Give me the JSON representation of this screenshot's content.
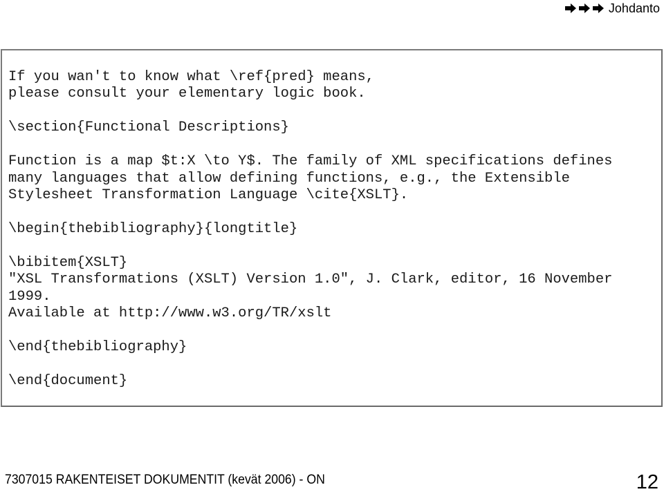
{
  "nav": {
    "icons": [
      "arrow-right-icon",
      "arrow-right-icon",
      "arrow-right-icon"
    ],
    "label": "Johdanto"
  },
  "code": {
    "lines": [
      "If you wan't to know what \\ref{pred} means,",
      "please consult your elementary logic book.",
      "",
      "\\section{Functional Descriptions}",
      "",
      "Function is a map $t:X \\to Y$. The family of XML specifications defines",
      "many languages that allow defining functions, e.g., the Extensible",
      "Stylesheet Transformation Language \\cite{XSLT}.",
      "",
      "\\begin{thebibliography}{longtitle}",
      "",
      "\\bibitem{XSLT}",
      "\"XSL Transformations (XSLT) Version 1.0\", J. Clark, editor, 16 November",
      "1999.",
      "Available at http://www.w3.org/TR/xslt",
      "",
      "\\end{thebibliography}",
      "",
      "\\end{document}"
    ]
  },
  "footer": {
    "course": "7307015 RAKENTEISET DOKUMENTIT (kevät 2006) - ON",
    "page_number": "12"
  }
}
